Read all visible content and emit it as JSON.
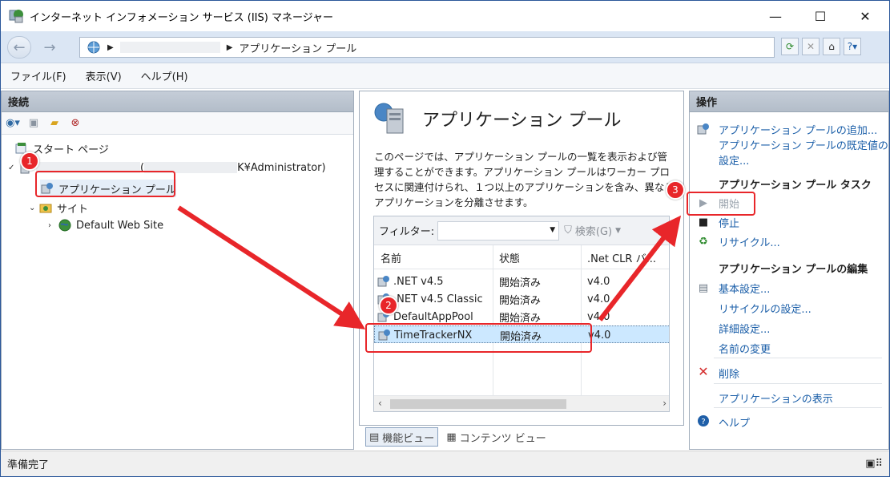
{
  "window": {
    "title": "インターネット インフォメーション サービス (IIS) マネージャー",
    "minimize": "—",
    "maximize": "☐",
    "close": "✕"
  },
  "address": {
    "crumb": "アプリケーション プール"
  },
  "menu": {
    "file": "ファイル(F)",
    "view": "表示(V)",
    "help": "ヘルプ(H)"
  },
  "connections": {
    "header": "接続",
    "tree": {
      "start_page": "スタート ページ",
      "server_suffix": "K¥Administrator)",
      "server_paren": "(",
      "app_pools": "アプリケーション プール",
      "sites": "サイト",
      "default_site": "Default Web Site"
    }
  },
  "center": {
    "heading": "アプリケーション プール",
    "description": "このページでは、アプリケーション プールの一覧を表示および管理することができます。アプリケーション プールはワーカー プロセスに関連付けられ、１つ以上のアプリケーションを含み、異なるアプリケーションを分離させます。",
    "filter_label": "フィルター:",
    "search_label": "検索(G)",
    "columns": [
      "名前",
      "状態",
      ".Net CLR バ..."
    ],
    "rows": [
      {
        "name": ".NET v4.5",
        "status": "開始済み",
        "clr": "v4.0"
      },
      {
        "name": ".NET v4.5 Classic",
        "status": "開始済み",
        "clr": "v4.0"
      },
      {
        "name": "DefaultAppPool",
        "status": "開始済み",
        "clr": "v4.0"
      },
      {
        "name": "TimeTrackerNX",
        "status": "開始済み",
        "clr": "v4.0"
      }
    ],
    "tabs": {
      "features": "機能ビュー",
      "content": "コンテンツ ビュー"
    }
  },
  "actions": {
    "header": "操作",
    "add_pool": "アプリケーション プールの追加...",
    "defaults_1": "アプリケーション プールの既定値の",
    "defaults_2": "設定...",
    "tasks_section": "アプリケーション プール タスク",
    "start": "開始",
    "stop": "停止",
    "recycle": "リサイクル...",
    "edit_section": "アプリケーション プールの編集",
    "basic_settings": "基本設定...",
    "recycle_settings": "リサイクルの設定...",
    "advanced_settings": "詳細設定...",
    "rename": "名前の変更",
    "delete": "削除",
    "view_apps": "アプリケーションの表示",
    "help": "ヘルプ"
  },
  "status": {
    "text": "準備完了"
  },
  "annotations": {
    "badge1": "1",
    "badge2": "2",
    "badge3": "3"
  },
  "colors": {
    "accent_red": "#e8262a",
    "link_blue": "#1a5ea8",
    "selection": "#cce8ff"
  }
}
